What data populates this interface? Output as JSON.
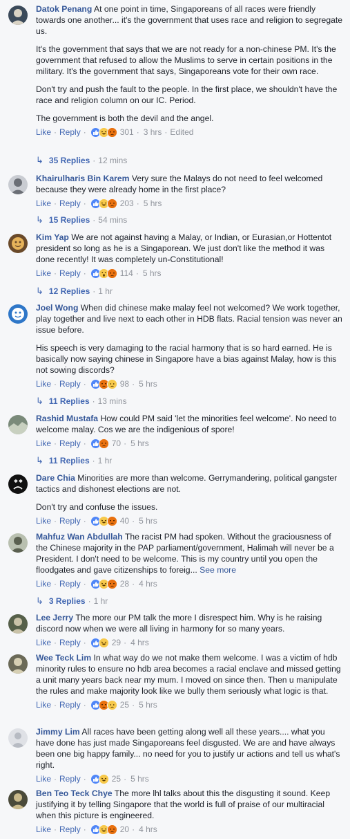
{
  "comments": [
    {
      "name": "Datok Penang",
      "avatar": {
        "bg": "#3b4a5a",
        "fg": "#d8d2c4",
        "kind": "person"
      },
      "paragraphs": [
        "At one point in time, Singaporeans of all races were friendly towards one another... it's the government that uses race and religion to segregate us.",
        "It's the government that says that we are not ready for a non-chinese PM. It's the government that refused to allow the Muslims to serve in certain positions in the military. It's the government that says, Singaporeans vote for their own race.",
        "Don't try and push the fault to the people. In the first place, we shouldn't have the race and religion column on our IC. Period.",
        "The government is both the devil and the angel."
      ],
      "see_more": "",
      "like": "Like",
      "reply": "Reply",
      "reactions": [
        "like",
        "haha",
        "angry"
      ],
      "count": "301",
      "time": "3 hrs",
      "edited": "Edited",
      "replies": {
        "count": "35 Replies",
        "time": "12 mins"
      }
    },
    {
      "name": "Khairulharis Bin Karem",
      "avatar": {
        "bg": "#c9ccd2",
        "fg": "#6b6f76",
        "kind": "person"
      },
      "paragraphs": [
        "Very sure the Malays do not need to feel welcomed because they were already home in the first place?"
      ],
      "see_more": "",
      "like": "Like",
      "reply": "Reply",
      "reactions": [
        "like",
        "haha",
        "angry"
      ],
      "count": "203",
      "time": "5 hrs",
      "edited": "",
      "replies": {
        "count": "15 Replies",
        "time": "54 mins"
      }
    },
    {
      "name": "Kim Yap",
      "avatar": {
        "bg": "#6a4a2a",
        "fg": "#e6b35a",
        "kind": "cartoon"
      },
      "paragraphs": [
        "We are not against having a Malay, or Indian, or Eurasian,or Hottentot president so long as he is a Singaporean. We just don't like the method it was done recently! It was completely un-Constitutional!"
      ],
      "see_more": "",
      "like": "Like",
      "reply": "Reply",
      "reactions": [
        "like",
        "wow",
        "angry"
      ],
      "count": "114",
      "time": "5 hrs",
      "edited": "",
      "replies": {
        "count": "12 Replies",
        "time": "1 hr"
      }
    },
    {
      "name": "Joel Wong",
      "avatar": {
        "bg": "#2f77c8",
        "fg": "#ffffff",
        "kind": "cartoon"
      },
      "paragraphs": [
        "When did chinese make malay feel not welcomed? We work together, play together and live next to each other in HDB flats. Racial tension was never an issue before.",
        "His speech is very damaging to the racial harmony that is so hard earned. He is basically now saying chinese in Singapore have a bias against Malay, how is this not sowing discords?"
      ],
      "see_more": "",
      "like": "Like",
      "reply": "Reply",
      "reactions": [
        "like",
        "angry",
        "sad"
      ],
      "count": "98",
      "time": "5 hrs",
      "edited": "",
      "replies": {
        "count": "11 Replies",
        "time": "13 mins"
      }
    },
    {
      "name": "Rashid Mustafa",
      "avatar": {
        "bg": "#7a8a7a",
        "fg": "#c8d0c0",
        "kind": "landscape"
      },
      "paragraphs": [
        "How could PM said 'let the minorities feel welcome'. No need to welcome malay. Cos we are the indigenious of spore!"
      ],
      "see_more": "",
      "like": "Like",
      "reply": "Reply",
      "reactions": [
        "like",
        "angry"
      ],
      "count": "70",
      "time": "5 hrs",
      "edited": "",
      "replies": {
        "count": "11 Replies",
        "time": "1 hr"
      }
    },
    {
      "name": "Dare Chia",
      "avatar": {
        "bg": "#111111",
        "fg": "#ffffff",
        "kind": "sadface"
      },
      "paragraphs": [
        "Minorities are more than welcome. Gerrymandering, political gangster tactics and dishonest elections are not.",
        "Don't try and confuse the issues."
      ],
      "see_more": "",
      "like": "Like",
      "reply": "Reply",
      "reactions": [
        "like",
        "haha",
        "angry"
      ],
      "count": "40",
      "time": "5 hrs",
      "edited": "",
      "replies": null
    },
    {
      "name": "Mahfuz Wan Abdullah",
      "avatar": {
        "bg": "#b9c0b0",
        "fg": "#5a6050",
        "kind": "person"
      },
      "paragraphs": [
        "The racist PM had spoken. Without the graciousness of the Chinese majority in the PAP parliament/government, Halimah will never be a President. I don't need to be welcome. This is my country until you open the floodgates and gave citizenships to foreig..."
      ],
      "see_more": "See more",
      "like": "Like",
      "reply": "Reply",
      "reactions": [
        "like",
        "haha",
        "angry"
      ],
      "count": "28",
      "time": "4 hrs",
      "edited": "",
      "replies": {
        "count": "3 Replies",
        "time": "1 hr"
      }
    },
    {
      "name": "Lee Jerry",
      "avatar": {
        "bg": "#56604a",
        "fg": "#c9c2a8",
        "kind": "person"
      },
      "paragraphs": [
        "The more our PM talk the more I disrespect him. Why is he raising discord now when we were all living in harmony for so many years."
      ],
      "see_more": "",
      "like": "Like",
      "reply": "Reply",
      "reactions": [
        "like",
        "haha"
      ],
      "count": "29",
      "time": "4 hrs",
      "edited": "",
      "replies": null
    },
    {
      "name": "Wee Teck Lim",
      "avatar": {
        "bg": "#6b6a58",
        "fg": "#d6cfb3",
        "kind": "person"
      },
      "paragraphs": [
        "In what way do we not make them welcome. I was a victim of hdb minority rules to ensure no hdb area becomes a racial enclave and missed getting a unit many years back near my mum. I moved on since then. Then u manipulate the rules and make majority look like we bully them seriously what logic is that."
      ],
      "see_more": "",
      "like": "Like",
      "reply": "Reply",
      "reactions": [
        "like",
        "angry",
        "sad"
      ],
      "count": "25",
      "time": "5 hrs",
      "edited": "",
      "replies": null
    },
    {
      "name": "Jimmy Lim",
      "avatar": {
        "bg": "#dfe1e6",
        "fg": "#b7bbc3",
        "kind": "default"
      },
      "paragraphs": [
        "All races have been getting along well all these years.... what you have done has just made Singaporeans feel disgusted. We are and have always been one big happy family... no need for you to justify ur actions and tell us what's right."
      ],
      "see_more": "",
      "like": "Like",
      "reply": "Reply",
      "reactions": [
        "like",
        "haha"
      ],
      "count": "25",
      "time": "5 hrs",
      "edited": "",
      "replies": null
    },
    {
      "name": "Ben Teo Teck Chye",
      "avatar": {
        "bg": "#4a4a3a",
        "fg": "#c9b98a",
        "kind": "person"
      },
      "paragraphs": [
        "The more lhl talks about this the disgusting it sound. Keep justifying it by telling Singapore that the world is full of praise of our multiracial when this picture is engineered."
      ],
      "see_more": "",
      "like": "Like",
      "reply": "Reply",
      "reactions": [
        "like",
        "haha",
        "angry"
      ],
      "count": "20",
      "time": "4 hrs",
      "edited": "",
      "replies": null
    }
  ]
}
